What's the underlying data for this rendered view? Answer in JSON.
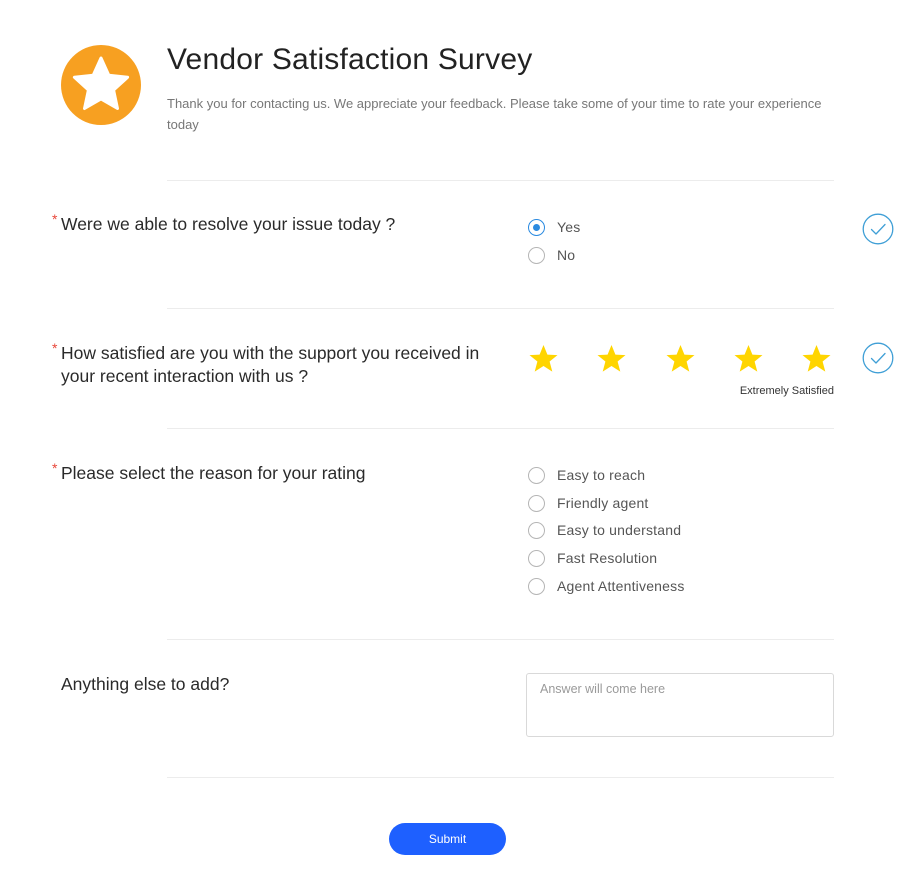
{
  "header": {
    "logo_icon": "star-badge-icon",
    "logo_color": "#f7a021",
    "title": "Vendor Satisfaction Survey",
    "subtitle": "Thank you for contacting us. We appreciate your feedback. Please take some of your time to rate your experience today"
  },
  "questions": {
    "q1": {
      "required_mark": "*",
      "label": "Were we able to resolve your issue today ?",
      "options": [
        "Yes",
        "No"
      ],
      "selected": "Yes",
      "answered_icon": "check-circle-icon"
    },
    "q2": {
      "required_mark": "*",
      "label": "How satisfied are you with the support you received in your recent interaction with us ?",
      "rating": 5,
      "max_rating": 5,
      "rating_caption": "Extremely Satisfied",
      "star_color": "#ffd500",
      "answered_icon": "check-circle-icon"
    },
    "q3": {
      "required_mark": "*",
      "label": "Please select the reason for your rating",
      "options": [
        "Easy to reach",
        "Friendly agent",
        "Easy to understand",
        "Fast Resolution",
        "Agent Attentiveness"
      ]
    },
    "q4": {
      "label": "Anything else to add?",
      "value": "",
      "placeholder": "Answer will come here"
    }
  },
  "submit_label": "Submit",
  "colors": {
    "accent": "#2a8ae0",
    "submit_bg": "#1e60ff",
    "required": "#e8473a",
    "check": "#3f9fd6"
  }
}
